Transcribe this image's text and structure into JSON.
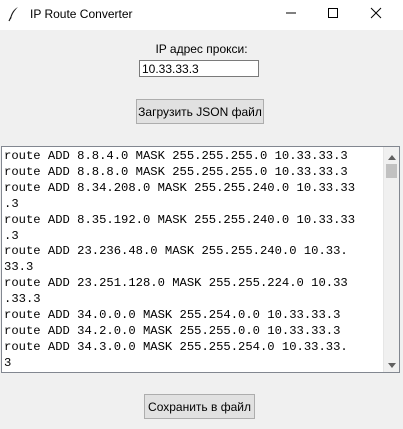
{
  "window": {
    "title": "IP Route Converter"
  },
  "proxy": {
    "label": "IP адрес прокси:",
    "value": "10.33.33.3"
  },
  "buttons": {
    "load_json": "Загрузить JSON файл",
    "save": "Сохранить в файл"
  },
  "output": {
    "lines": [
      "route ADD 8.8.4.0 MASK 255.255.255.0 10.33.33.3",
      "route ADD 8.8.8.0 MASK 255.255.255.0 10.33.33.3",
      "route ADD 8.34.208.0 MASK 255.255.240.0 10.33.33",
      ".3",
      "route ADD 8.35.192.0 MASK 255.255.240.0 10.33.33",
      ".3",
      "route ADD 23.236.48.0 MASK 255.255.240.0 10.33.",
      "33.3",
      "route ADD 23.251.128.0 MASK 255.255.224.0 10.33",
      ".33.3",
      "route ADD 34.0.0.0 MASK 255.254.0.0 10.33.33.3",
      "route ADD 34.2.0.0 MASK 255.255.0.0 10.33.33.3",
      "route ADD 34.3.0.0 MASK 255.255.254.0 10.33.33.",
      "3"
    ]
  },
  "icons": {
    "app": "feather-icon",
    "minimize": "minimize-icon",
    "maximize": "maximize-icon",
    "close": "close-icon",
    "scroll_up": "chevron-up-icon",
    "scroll_down": "chevron-down-icon"
  }
}
